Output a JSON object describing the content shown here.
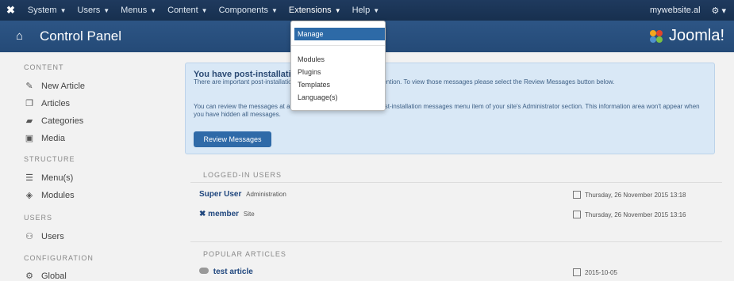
{
  "topnav": {
    "logo": "✖",
    "items": [
      {
        "label": "System"
      },
      {
        "label": "Users"
      },
      {
        "label": "Menus"
      },
      {
        "label": "Content"
      },
      {
        "label": "Components"
      },
      {
        "label": "Extensions"
      },
      {
        "label": "Help"
      }
    ],
    "site_link": "mywebsite.al",
    "settings_icon": "gear-icon"
  },
  "header": {
    "title": "Control Panel",
    "brand": "Joomla!"
  },
  "sidebar": {
    "sections": [
      {
        "title": "CONTENT",
        "items": [
          {
            "label": "New Article",
            "icon": "pencil-icon"
          },
          {
            "label": "Articles",
            "icon": "copy-icon"
          },
          {
            "label": "Categories",
            "icon": "folder-icon"
          },
          {
            "label": "Media",
            "icon": "image-icon"
          }
        ]
      },
      {
        "title": "STRUCTURE",
        "items": [
          {
            "label": "Menu(s)",
            "icon": "list-icon"
          },
          {
            "label": "Modules",
            "icon": "cube-icon"
          }
        ]
      },
      {
        "title": "USERS",
        "items": [
          {
            "label": "Users",
            "icon": "users-icon"
          }
        ]
      },
      {
        "title": "CONFIGURATION",
        "items": [
          {
            "label": "Global",
            "icon": "gear-icon"
          }
        ]
      }
    ]
  },
  "message": {
    "heading": "You have post-installation",
    "para1": "There are important post-installation messages that require your attention. To view those messages please select the Review Messages button below.",
    "para2": "You can review the messages at any time from the Components, Post-installation messages menu item of your site's Administrator section. This information area won't appear when you have hidden all messages.",
    "button": "Review Messages"
  },
  "logged_in": {
    "title": "LOGGED-IN USERS",
    "users": [
      {
        "name": "Super User",
        "role": "Administration",
        "date": "Thursday, 26 November 2015 13:18"
      },
      {
        "name": "member",
        "role": "Site",
        "date": "Thursday, 26 November 2015 13:16"
      }
    ]
  },
  "popular": {
    "title": "POPULAR ARTICLES",
    "articles": [
      {
        "title": "test article",
        "date": "2015-10-05"
      }
    ]
  },
  "dropdown": {
    "items": [
      "Manage",
      "Modules",
      "Plugins",
      "Templates",
      "Language(s)"
    ]
  },
  "colors": {
    "topnav": "#1f3a5e",
    "header": "#2d5585",
    "accent": "#2d6aa7",
    "message_bg": "#d9e8f6"
  }
}
